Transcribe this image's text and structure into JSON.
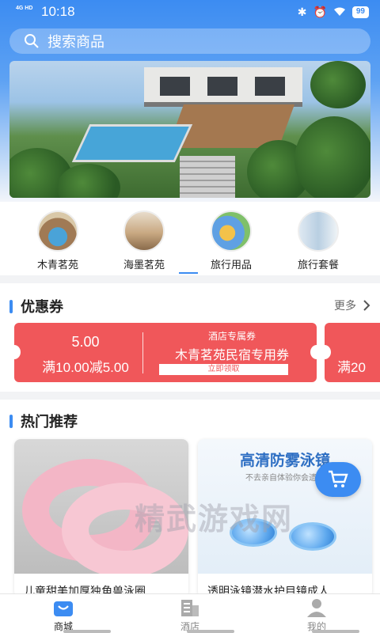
{
  "status_bar": {
    "network": "4G HD",
    "time": "10:18",
    "battery": "99"
  },
  "search": {
    "placeholder": "搜索商品"
  },
  "categories": [
    {
      "label": "木青茗苑"
    },
    {
      "label": "海墨茗苑"
    },
    {
      "label": "旅行用品"
    },
    {
      "label": "旅行套餐"
    }
  ],
  "coupons": {
    "title": "优惠券",
    "more": "更多",
    "items": [
      {
        "amount": "5.00",
        "condition": "满10.00减5.00",
        "tag": "酒店专属券",
        "name": "木青茗苑民宿专用券",
        "button": "立即领取"
      },
      {
        "condition": "满20"
      }
    ]
  },
  "hot": {
    "title": "热门推荐",
    "products": [
      {
        "title": "儿童甜美加厚独角兽泳圈"
      },
      {
        "title": "透明泳镜潜水护目镜成人…",
        "image_headline": "高清防雾泳镜",
        "image_sub": "不去亲自体验你会遗憾"
      }
    ]
  },
  "watermark": "精武游戏网",
  "tabs": [
    {
      "label": "商城",
      "active": true
    },
    {
      "label": "酒店",
      "active": false
    },
    {
      "label": "我的",
      "active": false
    }
  ],
  "colors": {
    "accent": "#3c8cf2",
    "coupon": "#f0575a"
  }
}
